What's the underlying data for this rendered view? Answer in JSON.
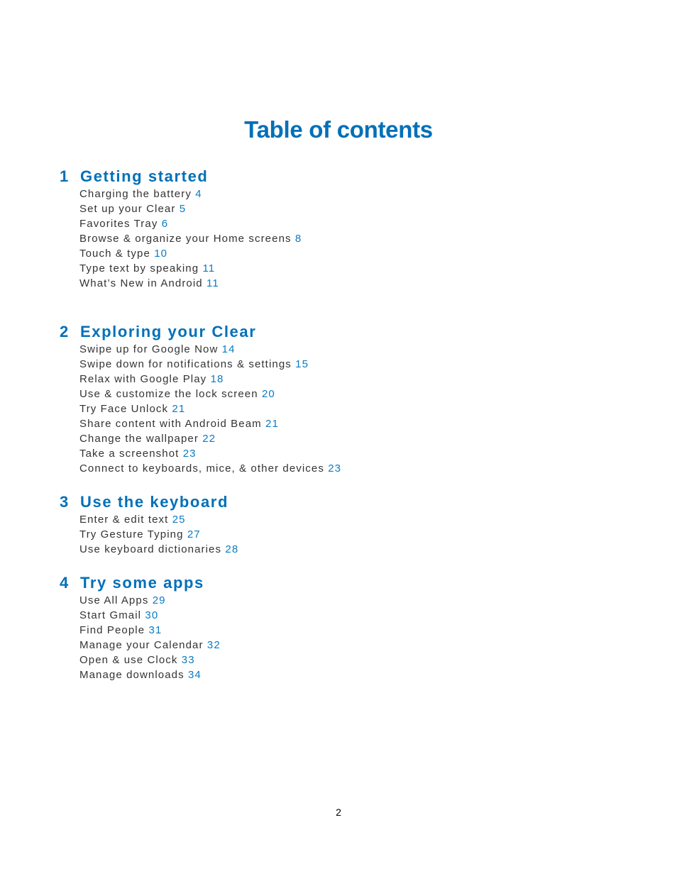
{
  "title": "Table of contents",
  "sections": [
    {
      "number": "1",
      "title": "Getting started",
      "items": [
        {
          "label": "Charging the battery",
          "page": "4"
        },
        {
          "label": "Set up your Clear",
          "page": "5"
        },
        {
          "label": "Favorites Tray",
          "page": "6"
        },
        {
          "label": "Browse & organize your Home screens",
          "page": "8"
        },
        {
          "label": "Touch & type",
          "page": "10"
        },
        {
          "label": "Type text by speaking",
          "page": "11"
        },
        {
          "label": "What’s New in Android",
          "page": "11"
        }
      ]
    },
    {
      "number": "2",
      "title": "Exploring your Clear",
      "items": [
        {
          "label": "Swipe up for Google Now",
          "page": "14"
        },
        {
          "label": "Swipe down for notifications & settings",
          "page": "15"
        },
        {
          "label": "Relax with Google Play",
          "page": "18"
        },
        {
          "label": "Use & customize the lock screen",
          "page": "20"
        },
        {
          "label": "Try Face Unlock",
          "page": "21"
        },
        {
          "label": "Share content with Android Beam",
          "page": "21"
        },
        {
          "label": "Change the wallpaper",
          "page": "22"
        },
        {
          "label": "Take a screenshot",
          "page": "23"
        },
        {
          "label": "Connect to keyboards, mice, & other devices",
          "page": "23"
        }
      ]
    },
    {
      "number": "3",
      "title": "Use the keyboard",
      "items": [
        {
          "label": "Enter & edit text",
          "page": "25"
        },
        {
          "label": "Try Gesture Typing",
          "page": "27"
        },
        {
          "label": "Use keyboard dictionaries",
          "page": "28"
        }
      ]
    },
    {
      "number": "4",
      "title": "Try some apps",
      "items": [
        {
          "label": "Use All Apps",
          "page": "29"
        },
        {
          "label": "Start Gmail",
          "page": "30"
        },
        {
          "label": "Find People",
          "page": "31"
        },
        {
          "label": "Manage your Calendar",
          "page": "32"
        },
        {
          "label": "Open & use Clock",
          "page": "33"
        },
        {
          "label": "Manage downloads",
          "page": "34"
        }
      ]
    }
  ],
  "footer": {
    "page_number": "2"
  },
  "colors": {
    "accent": "#0070b8",
    "body_text": "#333333"
  }
}
